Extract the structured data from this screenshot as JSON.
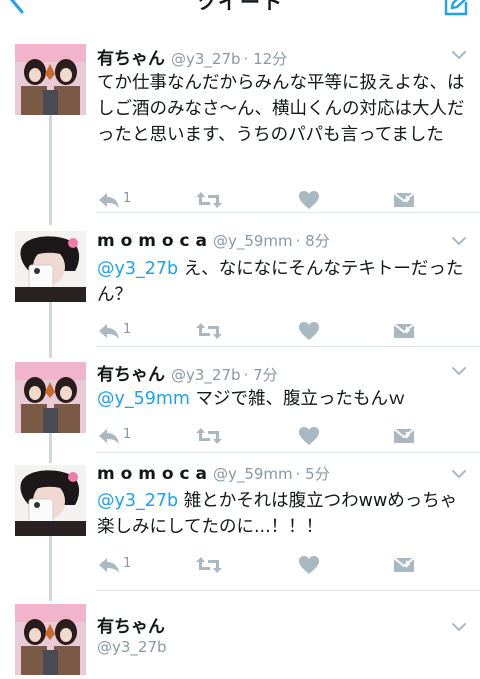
{
  "header": {
    "title": "ツイート"
  },
  "tweets": [
    {
      "name": "有ちゃん",
      "handle": "@y3_27b",
      "time": "· 12分",
      "text": "てか仕事なんだからみんな平等に扱えよな、はしご酒のみなさ〜ん、横山くんの対応は大人だったと思います、うちのパパも言ってました",
      "reply_count": "1"
    },
    {
      "name": "m o m o c a",
      "handle": "@y_59mm",
      "time": "· 8分",
      "mention": "@y3_27b",
      "text": " え、なになにそんなテキトーだったん？",
      "reply_count": "1"
    },
    {
      "name": "有ちゃん",
      "handle": "@y3_27b",
      "time": "· 7分",
      "mention": "@y_59mm",
      "text": " マジで雑、腹立ったもんｗ",
      "reply_count": "1"
    },
    {
      "name": "m o m o c a",
      "handle": "@y_59mm",
      "time": "· 5分",
      "mention": "@y3_27b",
      "text": " 雑とかそれは腹立つわwwめっちゃ楽しみにしてたのに...！！！",
      "reply_count": "1"
    }
  ],
  "focused": {
    "name": "有ちゃん",
    "handle": "@y3_27b"
  },
  "icons": {
    "back": "chevron-left-icon",
    "compose": "compose-icon",
    "reply": "reply-icon",
    "retweet": "retweet-icon",
    "like": "heart-icon",
    "dm": "envelope-icon",
    "more": "chevron-down-icon"
  },
  "colors": {
    "accent": "#1da1f2",
    "muted": "#8899a6",
    "divider": "#e1e8ed",
    "thread": "#cfd9de"
  }
}
